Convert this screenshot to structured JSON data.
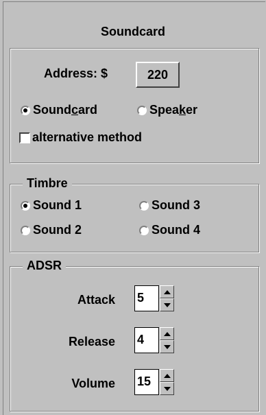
{
  "title": "Soundcard",
  "address": {
    "label": "Address: $",
    "value": "220"
  },
  "output": {
    "options": [
      {
        "label_pre": "Sound",
        "label_u": "c",
        "label_post": "ard",
        "selected": true
      },
      {
        "label_pre": "Spea",
        "label_u": "k",
        "label_post": "er",
        "selected": false
      }
    ],
    "alt_method": {
      "label": "alternative method",
      "checked": false
    }
  },
  "timbre": {
    "label": "Timbre",
    "options": [
      {
        "label": "Sound 1",
        "selected": true
      },
      {
        "label": "Sound 3",
        "selected": false
      },
      {
        "label": "Sound 2",
        "selected": false
      },
      {
        "label": "Sound 4",
        "selected": false
      }
    ]
  },
  "adsr": {
    "label": "ADSR",
    "attack": {
      "label": "Attack",
      "value": "5"
    },
    "release": {
      "label": "Release",
      "value": "4"
    },
    "volume": {
      "label": "Volume",
      "value": "15"
    }
  }
}
